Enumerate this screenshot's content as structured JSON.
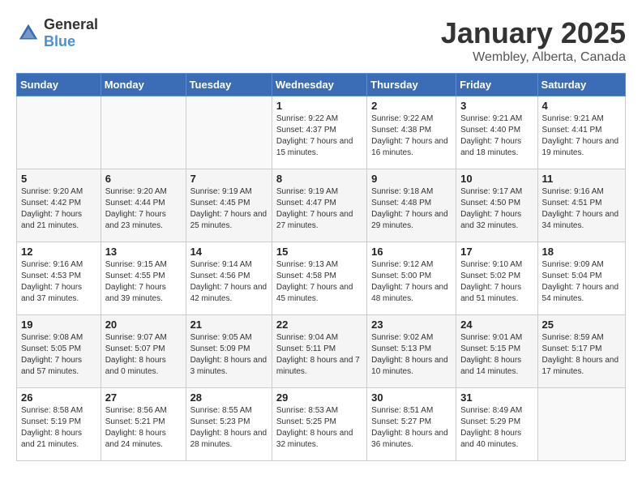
{
  "header": {
    "logo_general": "General",
    "logo_blue": "Blue",
    "month": "January 2025",
    "location": "Wembley, Alberta, Canada"
  },
  "weekdays": [
    "Sunday",
    "Monday",
    "Tuesday",
    "Wednesday",
    "Thursday",
    "Friday",
    "Saturday"
  ],
  "weeks": [
    [
      {
        "day": "",
        "sunrise": "",
        "sunset": "",
        "daylight": ""
      },
      {
        "day": "",
        "sunrise": "",
        "sunset": "",
        "daylight": ""
      },
      {
        "day": "",
        "sunrise": "",
        "sunset": "",
        "daylight": ""
      },
      {
        "day": "1",
        "sunrise": "Sunrise: 9:22 AM",
        "sunset": "Sunset: 4:37 PM",
        "daylight": "Daylight: 7 hours and 15 minutes."
      },
      {
        "day": "2",
        "sunrise": "Sunrise: 9:22 AM",
        "sunset": "Sunset: 4:38 PM",
        "daylight": "Daylight: 7 hours and 16 minutes."
      },
      {
        "day": "3",
        "sunrise": "Sunrise: 9:21 AM",
        "sunset": "Sunset: 4:40 PM",
        "daylight": "Daylight: 7 hours and 18 minutes."
      },
      {
        "day": "4",
        "sunrise": "Sunrise: 9:21 AM",
        "sunset": "Sunset: 4:41 PM",
        "daylight": "Daylight: 7 hours and 19 minutes."
      }
    ],
    [
      {
        "day": "5",
        "sunrise": "Sunrise: 9:20 AM",
        "sunset": "Sunset: 4:42 PM",
        "daylight": "Daylight: 7 hours and 21 minutes."
      },
      {
        "day": "6",
        "sunrise": "Sunrise: 9:20 AM",
        "sunset": "Sunset: 4:44 PM",
        "daylight": "Daylight: 7 hours and 23 minutes."
      },
      {
        "day": "7",
        "sunrise": "Sunrise: 9:19 AM",
        "sunset": "Sunset: 4:45 PM",
        "daylight": "Daylight: 7 hours and 25 minutes."
      },
      {
        "day": "8",
        "sunrise": "Sunrise: 9:19 AM",
        "sunset": "Sunset: 4:47 PM",
        "daylight": "Daylight: 7 hours and 27 minutes."
      },
      {
        "day": "9",
        "sunrise": "Sunrise: 9:18 AM",
        "sunset": "Sunset: 4:48 PM",
        "daylight": "Daylight: 7 hours and 29 minutes."
      },
      {
        "day": "10",
        "sunrise": "Sunrise: 9:17 AM",
        "sunset": "Sunset: 4:50 PM",
        "daylight": "Daylight: 7 hours and 32 minutes."
      },
      {
        "day": "11",
        "sunrise": "Sunrise: 9:16 AM",
        "sunset": "Sunset: 4:51 PM",
        "daylight": "Daylight: 7 hours and 34 minutes."
      }
    ],
    [
      {
        "day": "12",
        "sunrise": "Sunrise: 9:16 AM",
        "sunset": "Sunset: 4:53 PM",
        "daylight": "Daylight: 7 hours and 37 minutes."
      },
      {
        "day": "13",
        "sunrise": "Sunrise: 9:15 AM",
        "sunset": "Sunset: 4:55 PM",
        "daylight": "Daylight: 7 hours and 39 minutes."
      },
      {
        "day": "14",
        "sunrise": "Sunrise: 9:14 AM",
        "sunset": "Sunset: 4:56 PM",
        "daylight": "Daylight: 7 hours and 42 minutes."
      },
      {
        "day": "15",
        "sunrise": "Sunrise: 9:13 AM",
        "sunset": "Sunset: 4:58 PM",
        "daylight": "Daylight: 7 hours and 45 minutes."
      },
      {
        "day": "16",
        "sunrise": "Sunrise: 9:12 AM",
        "sunset": "Sunset: 5:00 PM",
        "daylight": "Daylight: 7 hours and 48 minutes."
      },
      {
        "day": "17",
        "sunrise": "Sunrise: 9:10 AM",
        "sunset": "Sunset: 5:02 PM",
        "daylight": "Daylight: 7 hours and 51 minutes."
      },
      {
        "day": "18",
        "sunrise": "Sunrise: 9:09 AM",
        "sunset": "Sunset: 5:04 PM",
        "daylight": "Daylight: 7 hours and 54 minutes."
      }
    ],
    [
      {
        "day": "19",
        "sunrise": "Sunrise: 9:08 AM",
        "sunset": "Sunset: 5:05 PM",
        "daylight": "Daylight: 7 hours and 57 minutes."
      },
      {
        "day": "20",
        "sunrise": "Sunrise: 9:07 AM",
        "sunset": "Sunset: 5:07 PM",
        "daylight": "Daylight: 8 hours and 0 minutes."
      },
      {
        "day": "21",
        "sunrise": "Sunrise: 9:05 AM",
        "sunset": "Sunset: 5:09 PM",
        "daylight": "Daylight: 8 hours and 3 minutes."
      },
      {
        "day": "22",
        "sunrise": "Sunrise: 9:04 AM",
        "sunset": "Sunset: 5:11 PM",
        "daylight": "Daylight: 8 hours and 7 minutes."
      },
      {
        "day": "23",
        "sunrise": "Sunrise: 9:02 AM",
        "sunset": "Sunset: 5:13 PM",
        "daylight": "Daylight: 8 hours and 10 minutes."
      },
      {
        "day": "24",
        "sunrise": "Sunrise: 9:01 AM",
        "sunset": "Sunset: 5:15 PM",
        "daylight": "Daylight: 8 hours and 14 minutes."
      },
      {
        "day": "25",
        "sunrise": "Sunrise: 8:59 AM",
        "sunset": "Sunset: 5:17 PM",
        "daylight": "Daylight: 8 hours and 17 minutes."
      }
    ],
    [
      {
        "day": "26",
        "sunrise": "Sunrise: 8:58 AM",
        "sunset": "Sunset: 5:19 PM",
        "daylight": "Daylight: 8 hours and 21 minutes."
      },
      {
        "day": "27",
        "sunrise": "Sunrise: 8:56 AM",
        "sunset": "Sunset: 5:21 PM",
        "daylight": "Daylight: 8 hours and 24 minutes."
      },
      {
        "day": "28",
        "sunrise": "Sunrise: 8:55 AM",
        "sunset": "Sunset: 5:23 PM",
        "daylight": "Daylight: 8 hours and 28 minutes."
      },
      {
        "day": "29",
        "sunrise": "Sunrise: 8:53 AM",
        "sunset": "Sunset: 5:25 PM",
        "daylight": "Daylight: 8 hours and 32 minutes."
      },
      {
        "day": "30",
        "sunrise": "Sunrise: 8:51 AM",
        "sunset": "Sunset: 5:27 PM",
        "daylight": "Daylight: 8 hours and 36 minutes."
      },
      {
        "day": "31",
        "sunrise": "Sunrise: 8:49 AM",
        "sunset": "Sunset: 5:29 PM",
        "daylight": "Daylight: 8 hours and 40 minutes."
      },
      {
        "day": "",
        "sunrise": "",
        "sunset": "",
        "daylight": ""
      }
    ]
  ]
}
